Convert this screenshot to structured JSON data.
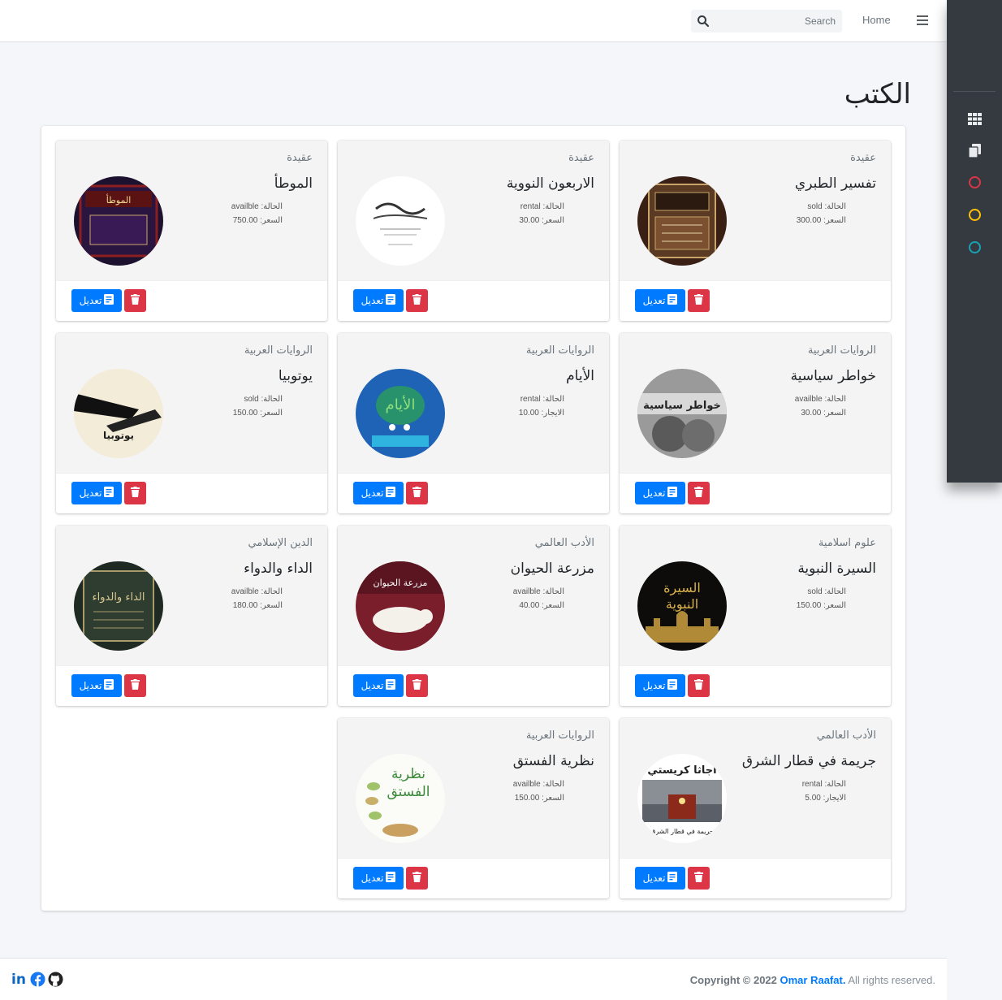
{
  "navbar": {
    "home_label": "Home",
    "search_placeholder": "Search"
  },
  "sidebar": {
    "items": [
      {
        "icon": "grid-icon"
      },
      {
        "icon": "copy-icon"
      },
      {
        "icon": "circle-icon",
        "color": "#dc3545"
      },
      {
        "icon": "circle-icon",
        "color": "#ffc107"
      },
      {
        "icon": "circle-icon",
        "color": "#17a2b8"
      }
    ]
  },
  "page": {
    "title": "الكتب"
  },
  "books": [
    {
      "category": "عقيدة",
      "title": "تفسير الطبري",
      "status_text": "الحالة: sold",
      "price_text": "السعر: 300.00"
    },
    {
      "category": "عقيدة",
      "title": "الاربعون النووية",
      "status_text": "الحالة: rental",
      "price_text": "السعر: 30.00"
    },
    {
      "category": "عقيدة",
      "title": "الموطأ",
      "status_text": "الحالة: availble",
      "price_text": "السعر: 750.00"
    },
    {
      "category": "الروايات العربية",
      "title": "خواطر سياسية",
      "status_text": "الحالة: availble",
      "price_text": "السعر: 30.00"
    },
    {
      "category": "الروايات العربية",
      "title": "الأيام",
      "status_text": "الحالة: rental",
      "price_text": "الايجار: 10.00"
    },
    {
      "category": "الروايات العربية",
      "title": "يوتوبيا",
      "status_text": "الحالة: sold",
      "price_text": "السعر: 150.00"
    },
    {
      "category": "علوم اسلامية",
      "title": "السيرة النبوية",
      "status_text": "الحالة: sold",
      "price_text": "السعر: 150.00"
    },
    {
      "category": "الأدب العالمي",
      "title": "مزرعة الحيوان",
      "status_text": "الحالة: availble",
      "price_text": "السعر: 40.00"
    },
    {
      "category": "الدين الإسلامي",
      "title": "الداء والدواء",
      "status_text": "الحالة: availble",
      "price_text": "السعر: 180.00"
    },
    {
      "category": "الأدب العالمي",
      "title": "جريمة في قطار الشرق",
      "status_text": "الحالة: rental",
      "price_text": "الايجار: 5.00"
    },
    {
      "category": "الروايات العربية",
      "title": "نظرية الفستق",
      "status_text": "الحالة: availble",
      "price_text": "السعر: 150.00"
    }
  ],
  "buttons": {
    "edit_label": "تعديل"
  },
  "footer": {
    "copyright_prefix": "Copyright © 2022",
    "author": "Omar Raafat.",
    "rights": "All rights reserved."
  },
  "socials": [
    "linkedin-icon",
    "facebook-icon",
    "github-icon"
  ]
}
